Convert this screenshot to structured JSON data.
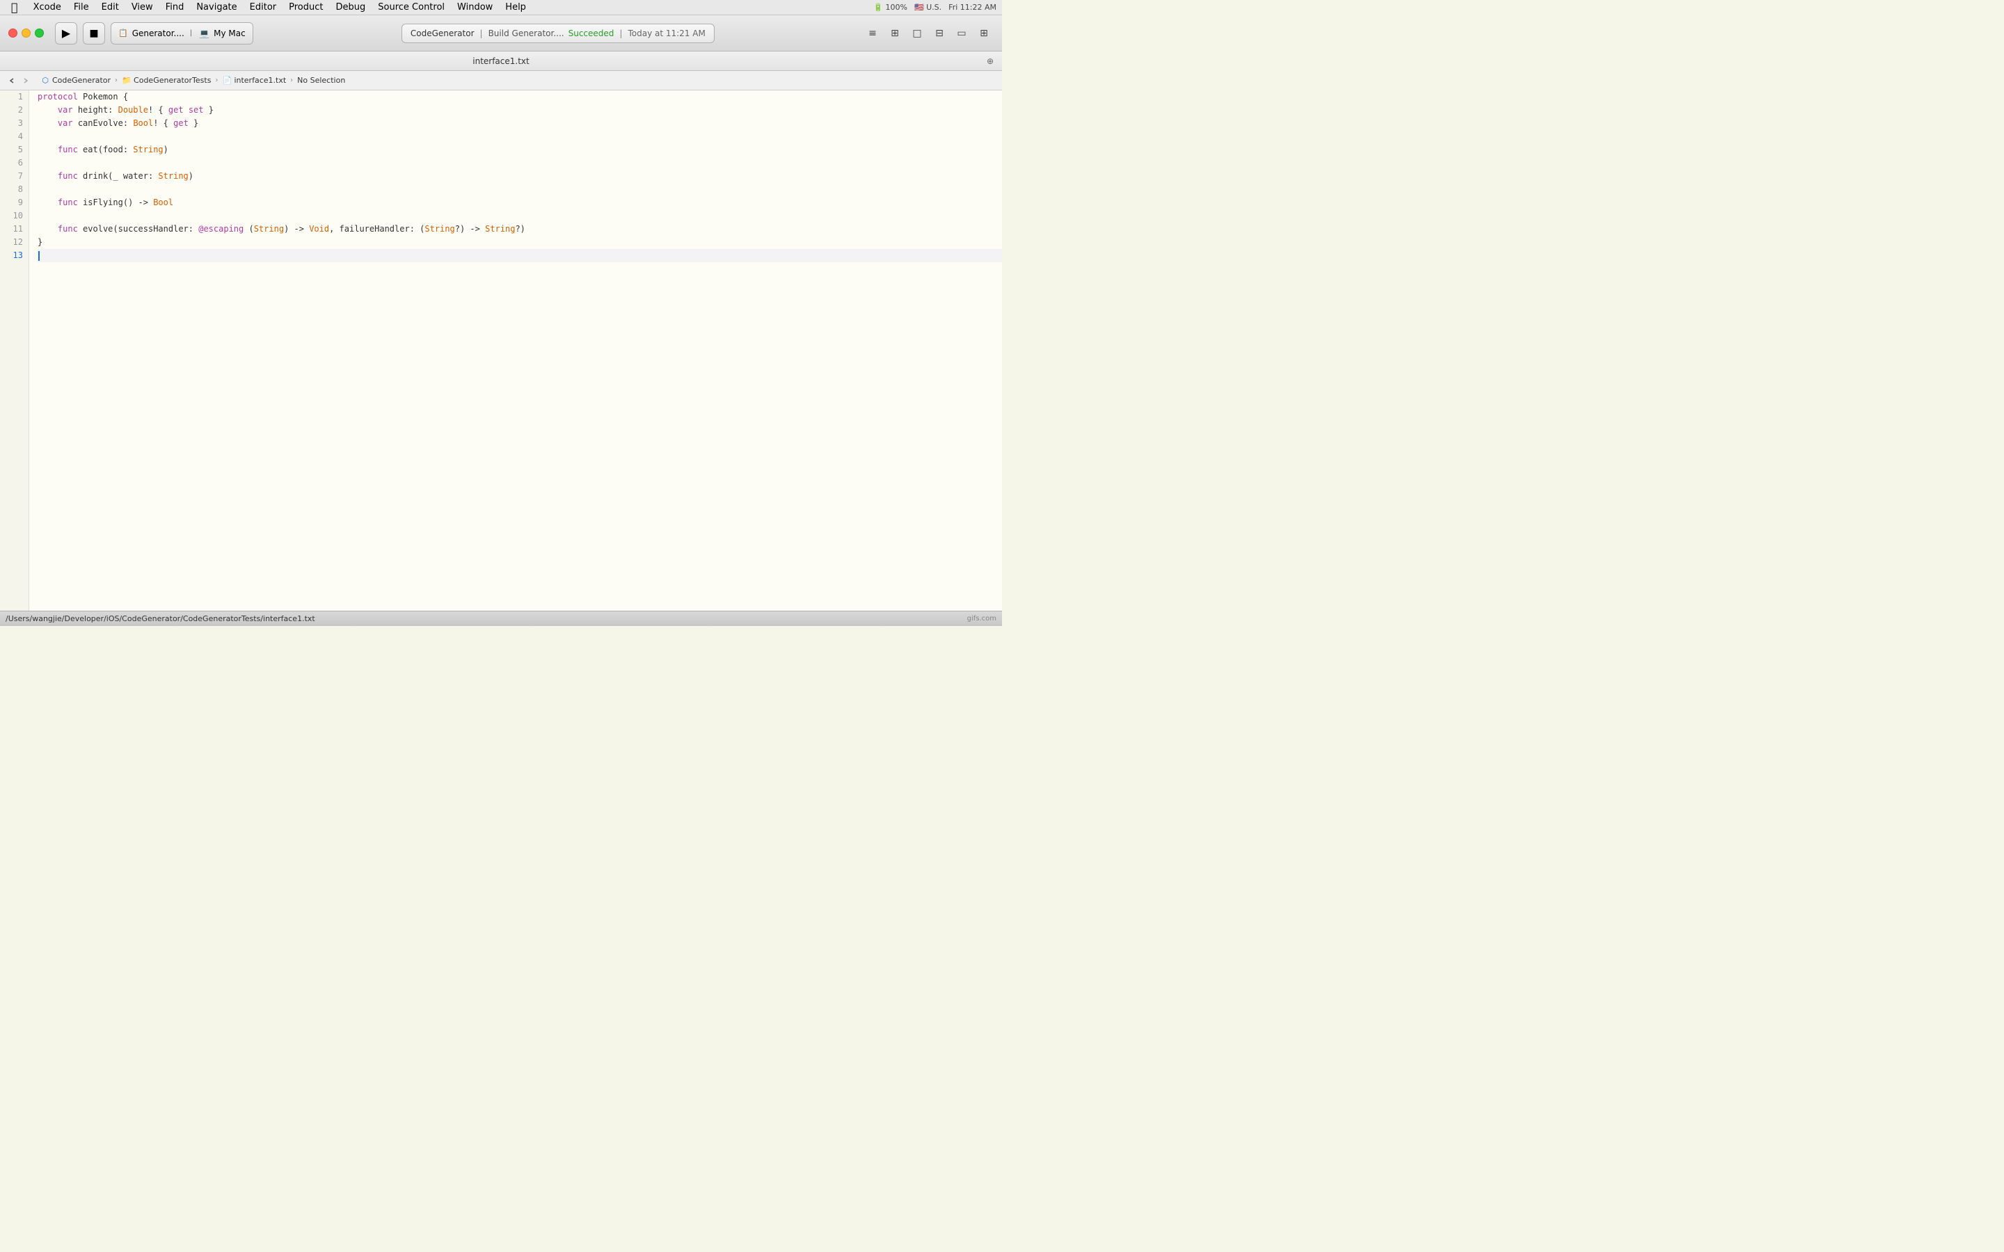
{
  "menubar": {
    "apple": "⌘",
    "items": [
      "Xcode",
      "File",
      "Edit",
      "View",
      "Find",
      "Navigate",
      "Editor",
      "Product",
      "Debug",
      "Source Control",
      "Window",
      "Help"
    ]
  },
  "toolbar": {
    "scheme": "Generator....",
    "destination": "My Mac",
    "build_app": "CodeGenerator",
    "build_action": "Build Generator....",
    "build_result": "Succeeded",
    "build_time": "Today at 11:21 AM"
  },
  "file_title": "interface1.txt",
  "breadcrumb": {
    "back": "<",
    "forward": ">",
    "project": "CodeGenerator",
    "folder": "CodeGeneratorTests",
    "file": "interface1.txt",
    "selection": "No Selection"
  },
  "code": {
    "lines": [
      {
        "num": 1,
        "text": "protocol Pokemon {"
      },
      {
        "num": 2,
        "text": "    var height: Double! { get set }"
      },
      {
        "num": 3,
        "text": "    var canEvolve: Bool! { get }"
      },
      {
        "num": 4,
        "text": ""
      },
      {
        "num": 5,
        "text": "    func eat(food: String)"
      },
      {
        "num": 6,
        "text": ""
      },
      {
        "num": 7,
        "text": "    func drink(_ water: String)"
      },
      {
        "num": 8,
        "text": ""
      },
      {
        "num": 9,
        "text": "    func isFlying() -> Bool"
      },
      {
        "num": 10,
        "text": ""
      },
      {
        "num": 11,
        "text": "    func evolve(successHandler: @escaping (String) -> Void, failureHandler: (String?) -> String?)"
      },
      {
        "num": 12,
        "text": "}"
      },
      {
        "num": 13,
        "text": ""
      }
    ]
  },
  "statusbar": {
    "path": "/Users/wangjie/Developer/iOS/CodeGenerator/CodeGeneratorTests/interface1.txt"
  },
  "system": {
    "time": "Fri 11:22 AM",
    "battery": "100%",
    "locale": "U.S."
  }
}
